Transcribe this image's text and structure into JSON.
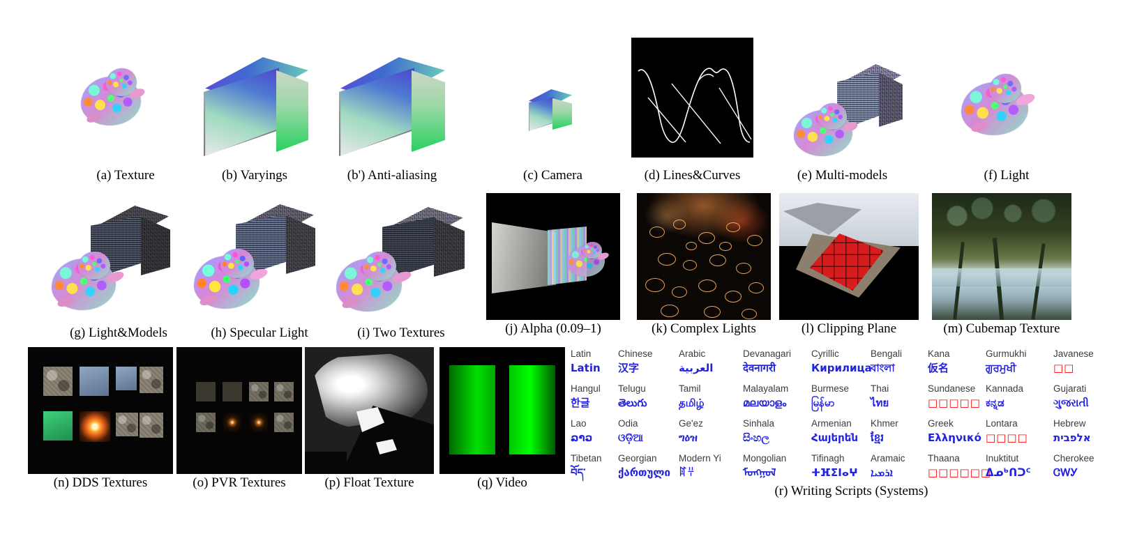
{
  "figure": {
    "rows": [
      {
        "panels": [
          {
            "id": "a",
            "caption": "(a) Texture",
            "kind": "bunny-white"
          },
          {
            "id": "b",
            "caption": "(b) Varyings",
            "kind": "gradient-cube"
          },
          {
            "id": "bprime",
            "caption": "(b') Anti-aliasing",
            "kind": "gradient-cube-aa"
          },
          {
            "id": "c",
            "caption": "(c) Camera",
            "kind": "small-cube"
          },
          {
            "id": "d",
            "caption": "(d) Lines&Curves",
            "kind": "lines-curves"
          },
          {
            "id": "e",
            "caption": "(e) Multi-models",
            "kind": "multi-models"
          },
          {
            "id": "f",
            "caption": "(f) Light",
            "kind": "light-bunny"
          }
        ]
      },
      {
        "panels": [
          {
            "id": "g",
            "caption": "(g) Light&Models",
            "kind": "light-models"
          },
          {
            "id": "h",
            "caption": "(h) Specular Light",
            "kind": "specular"
          },
          {
            "id": "i",
            "caption": "(i) Two Textures",
            "kind": "two-textures"
          },
          {
            "id": "j",
            "caption": "(j) Alpha (0.09–1)",
            "kind": "alpha"
          },
          {
            "id": "k",
            "caption": "(k) Complex Lights",
            "kind": "complex-lights"
          },
          {
            "id": "l",
            "caption": "(l) Clipping Plane",
            "kind": "clipping-plane"
          },
          {
            "id": "m",
            "caption": "(m) Cubemap Texture",
            "kind": "cubemap"
          }
        ]
      },
      {
        "panels": [
          {
            "id": "n",
            "caption": "(n) DDS Textures",
            "kind": "dds"
          },
          {
            "id": "o",
            "caption": "(o) PVR Textures",
            "kind": "pvr"
          },
          {
            "id": "p",
            "caption": "(p) Float Texture",
            "kind": "float-texture"
          },
          {
            "id": "q",
            "caption": "(q) Video",
            "kind": "video"
          },
          {
            "id": "r",
            "caption": "(r) Writing Scripts (Systems)",
            "kind": "scripts-table"
          }
        ]
      }
    ]
  },
  "scripts": {
    "caption": "(r) Writing Scripts (Systems)",
    "rows": [
      [
        {
          "name": "Latin",
          "sample": "Latin",
          "missing": false
        },
        {
          "name": "Chinese",
          "sample": "汉字",
          "missing": false
        },
        {
          "name": "Arabic",
          "sample": "العربية",
          "missing": false
        },
        {
          "name": "Devanagari",
          "sample": "देवनागरी",
          "missing": false
        },
        {
          "name": "Cyrillic",
          "sample": "Кирилица",
          "missing": false
        },
        {
          "name": "Bengali",
          "sample": "বাংলা",
          "missing": false
        },
        {
          "name": "Kana",
          "sample": "仮名",
          "missing": false
        },
        {
          "name": "Gurmukhi",
          "sample": "ਗੁਰਮੁਖੀ",
          "missing": false
        },
        {
          "name": "Javanese",
          "sample": "□□",
          "missing": true
        }
      ],
      [
        {
          "name": "Hangul",
          "sample": "한글",
          "missing": false
        },
        {
          "name": "Telugu",
          "sample": "తెలుగు",
          "missing": false
        },
        {
          "name": "Tamil",
          "sample": "தமிழ்",
          "missing": false
        },
        {
          "name": "Malayalam",
          "sample": "മലയാളം",
          "missing": false
        },
        {
          "name": "Burmese",
          "sample": "မြန်မာ",
          "missing": false
        },
        {
          "name": "Thai",
          "sample": "ไทย",
          "missing": false
        },
        {
          "name": "Sundanese",
          "sample": "□□□□□",
          "missing": true
        },
        {
          "name": "Kannada",
          "sample": "ಕನ್ನಡ",
          "missing": false
        },
        {
          "name": "Gujarati",
          "sample": "ગુજરાતી",
          "missing": false
        }
      ],
      [
        {
          "name": "Lao",
          "sample": "ລາວ",
          "missing": false
        },
        {
          "name": "Odia",
          "sample": "ଓଡ଼ିଆ",
          "missing": false
        },
        {
          "name": "Ge'ez",
          "sample": "ግዕዝ",
          "missing": false
        },
        {
          "name": "Sinhala",
          "sample": "සිංහල",
          "missing": false
        },
        {
          "name": "Armenian",
          "sample": "Հայերեն",
          "missing": false
        },
        {
          "name": "Khmer",
          "sample": "ខ្មែរ",
          "missing": false
        },
        {
          "name": "Greek",
          "sample": "Ελληνικό",
          "missing": false
        },
        {
          "name": "Lontara",
          "sample": "□□□□",
          "missing": true
        },
        {
          "name": "Hebrew",
          "sample": "אלפבית",
          "missing": false
        }
      ],
      [
        {
          "name": "Tibetan",
          "sample": "བོད་",
          "missing": false
        },
        {
          "name": "Georgian",
          "sample": "ქართული",
          "missing": false
        },
        {
          "name": "Modern Yi",
          "sample": "ꍏꇭ",
          "missing": false
        },
        {
          "name": "Mongolian",
          "sample": "ᠮᠣᠩᠭᠣᠯ",
          "missing": false
        },
        {
          "name": "Tifinagh",
          "sample": "ⵜⴼⵉⵏⴰⵖ",
          "missing": false
        },
        {
          "name": "Aramaic",
          "sample": "ܐܪܡܝܐ",
          "missing": false
        },
        {
          "name": "Thaana",
          "sample": "□□□□□□",
          "missing": true
        },
        {
          "name": "Inuktitut",
          "sample": "ᐃᓄᒃᑎᑐᑦ",
          "missing": false
        },
        {
          "name": "Cherokee",
          "sample": "ᏣᎳᎩ",
          "missing": false
        }
      ]
    ]
  },
  "colors": {
    "background": "#ffffff",
    "caption_text": "#000000",
    "script_name": "#3c3c3c",
    "script_sample": "#2222dd",
    "script_missing": "#ff0000",
    "panel_black": "#000000",
    "video_green": "#00ff00",
    "clip_red": "#d61c1c"
  }
}
